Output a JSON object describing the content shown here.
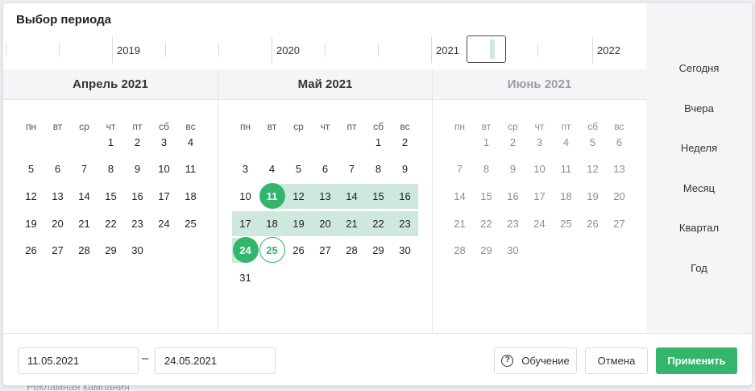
{
  "background": {
    "label": "Рекламная кампания"
  },
  "title": "Выбор периода",
  "timeline": {
    "years": [
      "2019",
      "2020",
      "2021",
      "2022"
    ]
  },
  "months": [
    {
      "name": "Апрель 2021"
    },
    {
      "name": "Май 2021"
    },
    {
      "name": "Июнь 2021"
    }
  ],
  "weekdays": [
    "пн",
    "вт",
    "ср",
    "чт",
    "пт",
    "сб",
    "вс"
  ],
  "selection": {
    "start_day": "11",
    "end_day": "24",
    "hover_day": "25"
  },
  "sidebar": {
    "items": [
      "Сегодня",
      "Вчера",
      "Неделя",
      "Месяц",
      "Квартал",
      "Год"
    ]
  },
  "footer": {
    "date_from": "11.05.2021",
    "date_to": "24.05.2021",
    "separator": "–",
    "help_label": "Обучение",
    "cancel_label": "Отмена",
    "apply_label": "Применить"
  },
  "colors": {
    "accent": "#33b56b",
    "range": "#cfe8dd",
    "sidebar_bg": "#f4f5f6"
  }
}
